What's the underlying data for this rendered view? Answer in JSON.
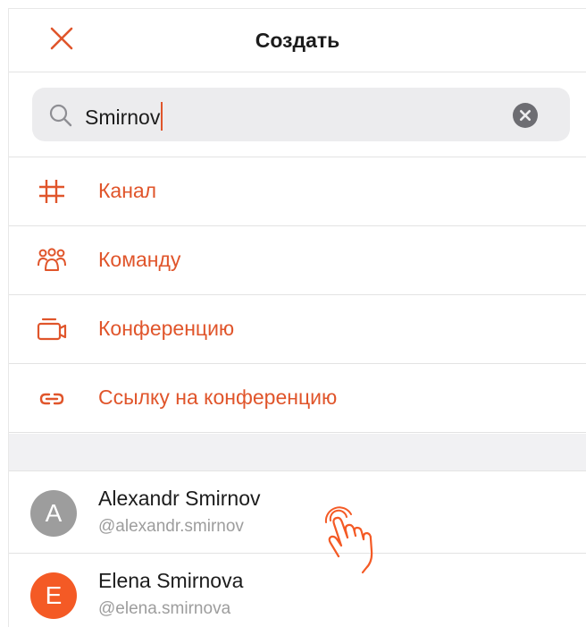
{
  "header": {
    "title": "Создать"
  },
  "search": {
    "value": "Smirnov"
  },
  "menu": {
    "items": [
      {
        "label": "Канал",
        "icon": "hash-icon"
      },
      {
        "label": "Команду",
        "icon": "team-icon"
      },
      {
        "label": "Конференцию",
        "icon": "video-camera-icon"
      },
      {
        "label": "Ссылку на конференцию",
        "icon": "link-icon"
      }
    ]
  },
  "contacts": [
    {
      "initial": "A",
      "name": "Alexandr Smirnov",
      "handle": "@alexandr.smirnov",
      "avatar_color": "#9d9d9d"
    },
    {
      "initial": "E",
      "name": "Elena Smirnova",
      "handle": "@elena.smirnova",
      "avatar_color": "#f45a25"
    }
  ],
  "colors": {
    "accent": "#e0552b",
    "text": "#1c1c1c",
    "muted": "#9d9d9d",
    "search_bg": "#ececee"
  }
}
